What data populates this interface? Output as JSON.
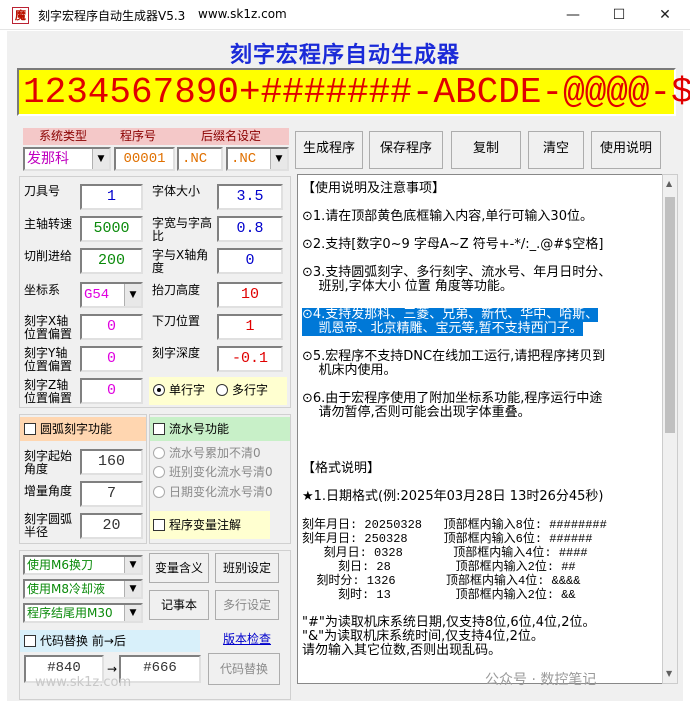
{
  "window": {
    "title": "刻字宏程序自动生成器V5.3",
    "url": "www.sk1z.com",
    "minimize": "—",
    "maximize": "☐",
    "close": "✕"
  },
  "heading": "刻字宏程序自动生成器",
  "code_input": "1234567890+#######-ABCDE-@@@@-$",
  "system": {
    "type_label": "系统类型",
    "prog_label": "程序号",
    "ext_label": "后缀名设定",
    "type_value": "发那科",
    "prog_value": "00001",
    "ext_value1": ".NC",
    "ext_value2": ".NC"
  },
  "params": {
    "tool_no_label": "刀具号",
    "tool_no": "1",
    "font_size_label": "字体大小",
    "font_size": "3.5",
    "spindle_label": "主轴转速",
    "spindle": "5000",
    "ratio_label": "字宽与字高比",
    "ratio": "0.8",
    "feed_label": "切削进给",
    "feed": "200",
    "angle_label": "字与X轴角度",
    "angle": "0",
    "coord_label": "坐标系",
    "coord": "G54",
    "lift_label": "抬刀高度",
    "lift": "10",
    "x_off_label": "刻字X轴位置偏置",
    "x_off": "0",
    "down_label": "下刀位置",
    "down": "1",
    "y_off_label": "刻字Y轴位置偏置",
    "y_off": "0",
    "depth_label": "刻字深度",
    "depth": "-0.1",
    "z_off_label": "刻字Z轴位置偏置",
    "z_off": "0",
    "single_line": "单行字",
    "multi_line": "多行字"
  },
  "arc": {
    "enable_label": "圆弧刻字功能",
    "start_angle_label": "刻字起始角度",
    "start_angle": "160",
    "incr_angle_label": "增量角度",
    "incr_angle": "7",
    "radius_label": "刻字圆弧半径",
    "radius": "20"
  },
  "serial": {
    "enable_label": "流水号功能",
    "opt1": "流水号累加不清0",
    "opt2": "班别变化流水号清0",
    "opt3": "日期变化流水号清0",
    "var_comment_label": "程序变量注解"
  },
  "bottom": {
    "combo1": "使用M6换刀",
    "combo2": "使用M8冷却液",
    "combo3": "程序结尾用M30",
    "var_meaning": "变量含义",
    "shift_setting": "班别设定",
    "notepad": "记事本",
    "multi_setting": "多行设定",
    "code_replace_label": "代码替换  前→后",
    "version_check": "版本检查",
    "replace_from": "#840",
    "arrow": "→",
    "replace_to": "#666",
    "replace_button": "代码替换"
  },
  "toolbar": {
    "generate": "生成程序",
    "save": "保存程序",
    "copy": "复制",
    "clear": "清空",
    "help": "使用说明"
  },
  "help_lines": [
    "【使用说明及注意事项】",
    "⊙1.请在顶部黄色底框输入内容,单行可输入30位。",
    "⊙2.支持[数字0~9 字母A~Z 符号+-*/:_.@#$空格]",
    "⊙3.支持圆弧刻字、多行刻字、流水号、年月日时分、",
    "    班别,字体大小 位置 角度等功能。",
    "⊙4.支持发那科、三菱、兄弟、新代、华中、哈斯、",
    "    凯恩帝、北京精雕、宝元等,暂不支持西门子。",
    "⊙5.宏程序不支持DNC在线加工运行,请把程序拷贝到",
    "    机床内使用。",
    "⊙6.由于宏程序使用了附加坐标系功能,程序运行中途",
    "    请勿暂停,否则可能会出现字体重叠。",
    "【格式说明】",
    "★1.日期格式(例:2025年03月28日 13时26分45秒)",
    "刻年月日: 20250328   顶部框内输入8位: ########",
    "刻年月日: 250328     顶部框内输入6位: ######",
    "   刻月日: 0328       顶部框内输入4位: ####",
    "     刻日: 28         顶部框内输入2位: ##",
    "  刻时分: 1326       顶部框内输入4位: &&&&",
    "     刻时: 13         顶部框内输入2位: &&",
    "\"#\"为读取机床系统日期,仅支持8位,6位,4位,2位。",
    "\"&\"为读取机床系统时间,仅支持4位,2位。",
    "请勿输入其它位数,否则出现乱码。"
  ],
  "watermark_left": "www.sk1z.com",
  "watermark_right": "公众号 · 数控笔记"
}
